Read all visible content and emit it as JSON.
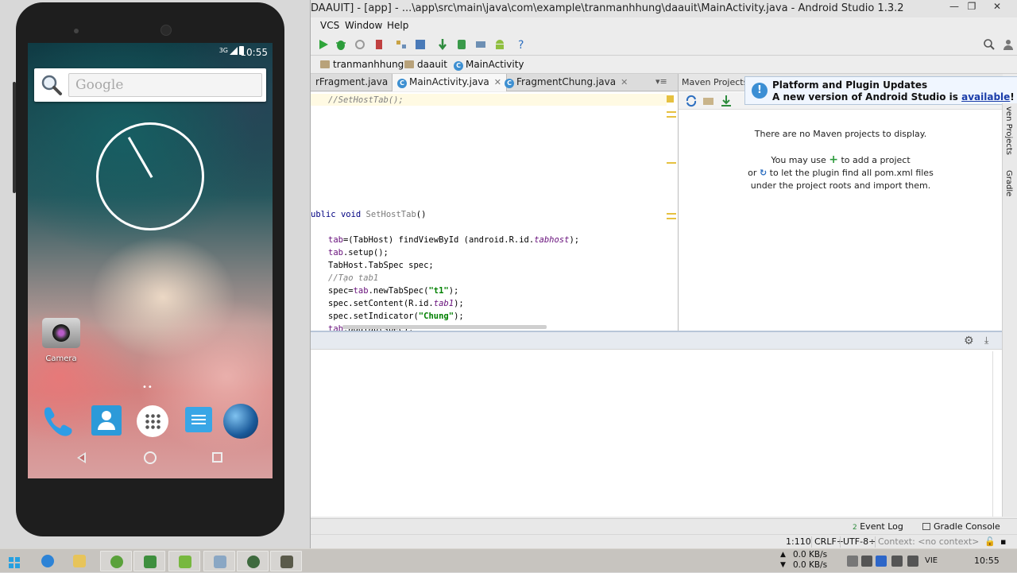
{
  "emulator": {
    "status_bar": {
      "network": "3G",
      "time": "10:55"
    },
    "search_placeholder": "Google",
    "apps": [
      {
        "label": "Camera"
      }
    ],
    "pager_indicator": "••",
    "dock": [
      "phone-icon",
      "contacts-icon",
      "app-drawer-icon",
      "messaging-icon",
      "browser-icon"
    ],
    "nav": [
      "back-icon",
      "home-icon",
      "recents-icon"
    ]
  },
  "ide": {
    "title": "DAAUIT] - [app] - ...\\app\\src\\main\\java\\com\\example\\tranmanhhung\\daauit\\MainActivity.java - Android Studio 1.3.2",
    "window_buttons": {
      "minimize": "—",
      "restore": "❐",
      "close": "✕"
    },
    "menu": [
      "VCS",
      "Window",
      "Help"
    ],
    "breadcrumbs": [
      "tranmanhhung",
      "daauit",
      "MainActivity"
    ],
    "tabs": [
      {
        "label": "rFragment.java",
        "close": "✕",
        "active": false
      },
      {
        "label": "MainActivity.java",
        "close": "✕",
        "active": true
      },
      {
        "label": "FragmentChung.java",
        "close": "✕",
        "active": false
      }
    ],
    "tab_overflow": "▾≡",
    "maven": {
      "title": "Maven Projects",
      "empty_message": "There are no Maven projects to display.",
      "hint_line1_a": "You may use",
      "hint_line1_b": "to add a project",
      "hint_line2_a": "or",
      "hint_line2_b": "to let the plugin find all pom.xml files",
      "hint_line3": "under the project roots and import them."
    },
    "notification": {
      "title": "Platform and Plugin Updates",
      "body_prefix": "A new version of Android Studio is",
      "link": "available",
      "body_suffix": "!"
    },
    "side_tabs": [
      "ven Projects",
      "Gradle"
    ],
    "code": {
      "l1": "//SetHostTab();",
      "l2a": "ublic ",
      "l2b": "void",
      "l2c": " SetHostTab",
      "l2d": "()",
      "l3a": "tab",
      "l3b": "=(TabHost) findViewById (android.R.id.",
      "l3c": "tabhost",
      "l3d": ");",
      "l4a": "tab",
      "l4b": ".setup();",
      "l5": "TabHost.TabSpec spec;",
      "l6": "//Tạo tab1",
      "l7a": "spec=",
      "l7b": "tab",
      "l7c": ".newTabSpec(",
      "l7d": "\"t1\"",
      "l7e": ");",
      "l8a": "spec.setContent(R.id.",
      "l8b": "tab1",
      "l8c": ");",
      "l9a": "spec.setIndicator(",
      "l9b": "\"Chung\"",
      "l9c": ");",
      "l10a": "tab",
      "l10b": ".addTab(spec);"
    },
    "tool_windows": [
      {
        "label": "Event Log",
        "badge": "2"
      },
      {
        "label": "Gradle Console"
      }
    ],
    "status": {
      "position": "1:110",
      "line_sep": "CRLF÷",
      "encoding": "UTF-8÷",
      "context": "Context: <no context>"
    }
  },
  "taskbar": {
    "net_up": "0.0 KB/s",
    "net_down": "0.0 KB/s",
    "language": "VIE",
    "time": "10:55"
  }
}
